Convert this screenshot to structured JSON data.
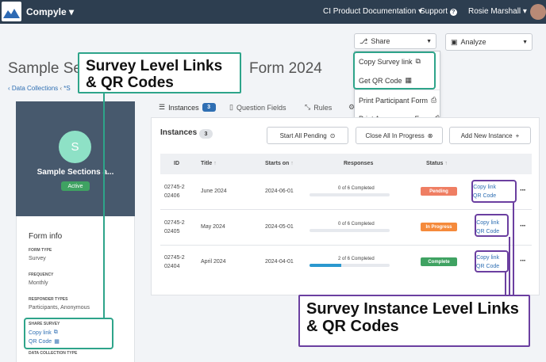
{
  "topbar": {
    "brand": "Compyle",
    "nav_docs": "CI Product Documentation",
    "nav_support": "Support",
    "nav_user": "Rosie Marshall"
  },
  "toolbar": {
    "share_label": "Share",
    "analyze_label": "Analyze"
  },
  "share_menu": {
    "items": [
      "Copy Survey link",
      "Get QR Code",
      "Print Participant Form",
      "Print Anonymous Form"
    ]
  },
  "page": {
    "title_left": "Sample Se",
    "title_right": "Form 2024",
    "breadcrumb_data": "Data Collections",
    "breadcrumb_current": "*S"
  },
  "profile": {
    "initial": "S",
    "name": "Sample Sections a...",
    "status": "Active"
  },
  "form_info": {
    "title": "Form info",
    "form_type_label": "FORM TYPE",
    "form_type": "Survey",
    "frequency_label": "FREQUENCY",
    "frequency": "Monthly",
    "responder_label": "RESPONDER TYPES",
    "responder": "Participants, Anonymous",
    "share_label": "SHARE SURVEY",
    "copy_link": "Copy link",
    "qr_code": "QR Code",
    "collection_type_label": "DATA COLLECTION TYPE"
  },
  "tabs": {
    "instances": "Instances",
    "instances_count": "3",
    "question_fields": "Question Fields",
    "rules": "Rules"
  },
  "instances": {
    "title": "Instances",
    "count": "3",
    "start_all": "Start All Pending",
    "close_all": "Close All In Progress",
    "add_new": "Add New Instance",
    "columns": {
      "id": "ID",
      "title": "Title",
      "starts_on": "Starts on",
      "responses": "Responses",
      "status": "Status"
    },
    "rows": [
      {
        "id_a": "02745-2",
        "id_b": "02406",
        "title": "June 2024",
        "starts_on": "2024-06-01",
        "responses": "0 of 6 Completed",
        "progress": 0,
        "status": "Pending",
        "status_color": "#ef7e63",
        "copy_link": "Copy link",
        "qr_code": "QR Code"
      },
      {
        "id_a": "02745-2",
        "id_b": "02405",
        "title": "May 2024",
        "starts_on": "2024-05-01",
        "responses": "0 of 6 Completed",
        "progress": 0,
        "status": "In Progress",
        "status_color": "#f58a3b",
        "copy_link": "Copy link",
        "qr_code": "QR Code"
      },
      {
        "id_a": "02745-2",
        "id_b": "02404",
        "title": "April 2024",
        "starts_on": "2024-04-01",
        "responses": "2 of 6 Completed",
        "progress": 0.4,
        "status": "Complete",
        "status_color": "#3fa262",
        "copy_link": "Copy link",
        "qr_code": "QR Code"
      }
    ]
  },
  "callouts": {
    "survey_level_line1": "Survey Level Links",
    "survey_level_line2": "& QR Codes",
    "instance_level_line1": "Survey Instance Level Links",
    "instance_level_line2": "& QR Codes"
  },
  "colors": {
    "topbar": "#2d3e50",
    "accent_blue": "#2f6fb3",
    "callout_green": "#2ea48a",
    "callout_purple": "#6b3fa0"
  }
}
